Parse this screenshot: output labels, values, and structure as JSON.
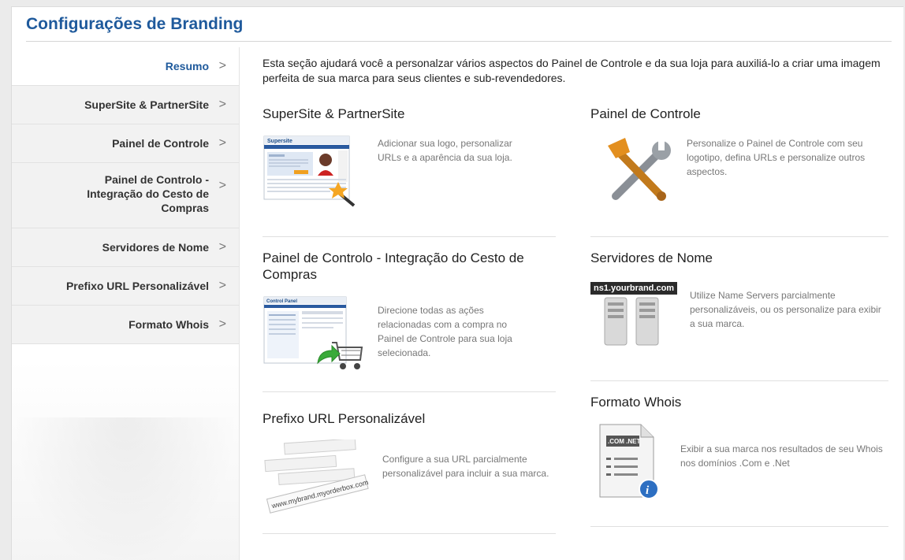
{
  "page": {
    "title": "Configurações de Branding"
  },
  "sidebar": {
    "items": [
      {
        "label": "Resumo",
        "active": true
      },
      {
        "label": "SuperSite & PartnerSite"
      },
      {
        "label": "Painel de Controle"
      },
      {
        "label": "Painel de Controlo - Integração do Cesto de Compras"
      },
      {
        "label": "Servidores de Nome"
      },
      {
        "label": "Prefixo URL Personalizável"
      },
      {
        "label": "Formato Whois"
      }
    ],
    "chevron": ">"
  },
  "intro": "Esta seção ajudará você a personalzar vários aspectos do Painel de Controle e da sua loja para auxiliá-lo a criar uma imagem perfeita de sua marca para seus clientes e sub-revendedores.",
  "sections": {
    "supersite": {
      "title": "SuperSite & PartnerSite",
      "desc": "Adicionar sua logo, personalizar URLs e a aparência da sua loja.",
      "icon": "supersite-screenshot-icon"
    },
    "control_panel": {
      "title": "Painel de Controle",
      "desc": "Personalize o Painel de Controle com seu logotipo, defina URLs e personalize outros aspectos.",
      "icon": "tools-icon"
    },
    "cart": {
      "title": "Painel de Controlo - Integração do Cesto de Compras",
      "desc": "Direcione todas as ações relacionadas com a compra no Painel de Controle para sua loja selecionada.",
      "icon": "shopping-cart-icon",
      "thumb_header": "Control Panel"
    },
    "nameservers": {
      "title": "Servidores de Nome",
      "desc": "Utilize Name Servers parcialmente personalizáveis, ou os personalize para exibir a sua marca.",
      "icon": "servers-icon",
      "ns_label": "ns1.yourbrand.com"
    },
    "url_prefix": {
      "title": "Prefixo URL Personalizável",
      "desc": "Configure a sua URL parcialmente personalizável para incluir a sua marca.",
      "icon": "url-tags-icon",
      "tag_text": "www.mybrand.myorderbox.com"
    },
    "whois": {
      "title": "Formato Whois",
      "desc": "Exibir a sua marca nos resultados de seu Whois nos domínios .Com e .Net",
      "icon": "whois-document-icon",
      "doc_label": ".COM .NET"
    }
  },
  "colors": {
    "brand": "#1f5a9c",
    "text": "#222222",
    "muted": "#777777"
  }
}
